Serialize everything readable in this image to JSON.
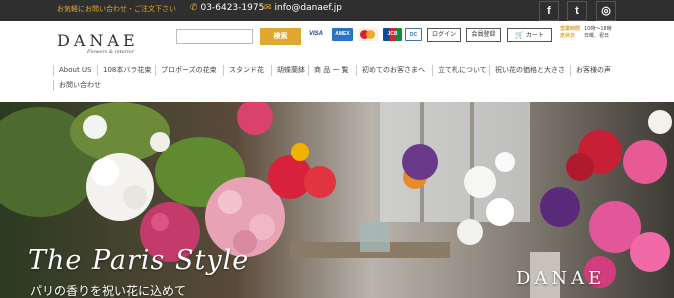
{
  "topbar": {
    "notice": "お気軽にお問い合わせ・ご注文下さい",
    "phone": "03-6423-1975",
    "email": "info@danaef.jp",
    "social": [
      {
        "icon": "facebook-icon",
        "glyph": "f"
      },
      {
        "icon": "twitter-icon",
        "glyph": "t"
      },
      {
        "icon": "instagram-icon",
        "glyph": "◎"
      }
    ]
  },
  "header": {
    "logo_main": "DANAE",
    "logo_sub": "Flowers & interior",
    "search_placeholder": "",
    "search_label": "検索",
    "cards": {
      "visa": "VISA",
      "amex": "AMEX",
      "jcb": "JCB",
      "diners": "DC"
    },
    "login_label": "ログイン",
    "signup_label": "会員登録",
    "cart_label": "カート",
    "hours": {
      "open_label": "営業時間",
      "open_value": "10時〜18時",
      "closed_label": "定休日",
      "closed_value": "日曜、祝日"
    }
  },
  "nav": {
    "items": [
      "About US",
      "108本バラ花束",
      "プロポーズの花束",
      "スタンド花",
      "胡蝶蘭鉢",
      "商 品 一 覧",
      "初めてのお客さまへ",
      "立て札について",
      "祝い花の価格と大きさ",
      "お客様の声",
      "お問い合わせ"
    ]
  },
  "hero": {
    "title": "The Paris Style",
    "subtitle": "パリの香りを祝い花に込めて",
    "brand": "DANAE"
  },
  "colors": {
    "accent": "#e0a733",
    "topbar": "#2f2f2f"
  }
}
